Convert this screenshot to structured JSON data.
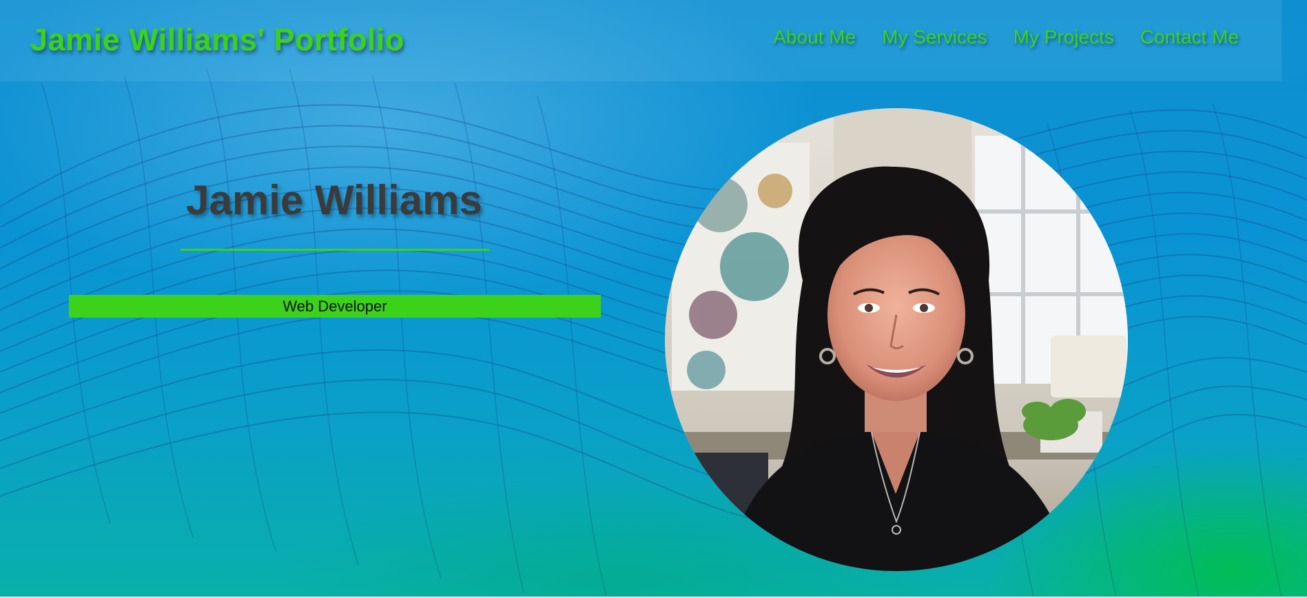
{
  "header": {
    "brand": "Jamie Williams' Portfolio",
    "nav": [
      {
        "label": "About Me"
      },
      {
        "label": "My Services"
      },
      {
        "label": "My Projects"
      },
      {
        "label": "Contact Me"
      }
    ]
  },
  "hero": {
    "name": "Jamie Williams",
    "role": "Web Developer"
  },
  "colors": {
    "accent": "#3cd21c",
    "heading": "#3b3b3b",
    "background": "#0a93d4"
  }
}
